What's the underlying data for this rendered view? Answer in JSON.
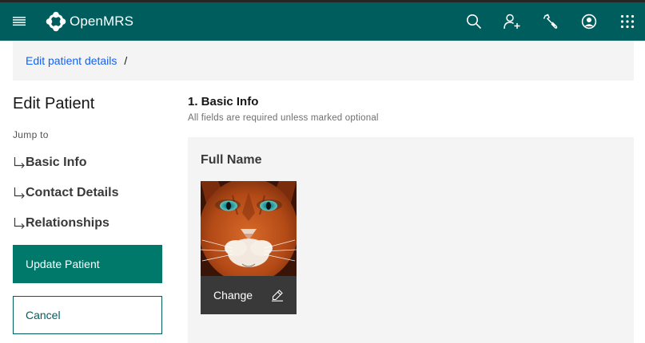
{
  "header": {
    "brand": "OpenMRS",
    "icons": [
      "menu-icon",
      "openmrs-logo-icon",
      "search-icon",
      "add-patient-icon",
      "system-admin-icon",
      "user-avatar-icon",
      "app-switcher-icon"
    ]
  },
  "breadcrumb": {
    "link": "Edit patient details",
    "separator": "/"
  },
  "sidebar": {
    "title": "Edit Patient",
    "jump_to": "Jump to",
    "links": [
      "Basic Info",
      "Contact Details",
      "Relationships"
    ],
    "update_label": "Update Patient",
    "cancel_label": "Cancel"
  },
  "section": {
    "title": "1. Basic Info",
    "subtitle": "All fields are required unless marked optional",
    "field_title": "Full Name",
    "change_label": "Change"
  },
  "colors": {
    "header_bg": "#005d5d",
    "primary_button": "#00796b",
    "link": "#0f62fe"
  }
}
